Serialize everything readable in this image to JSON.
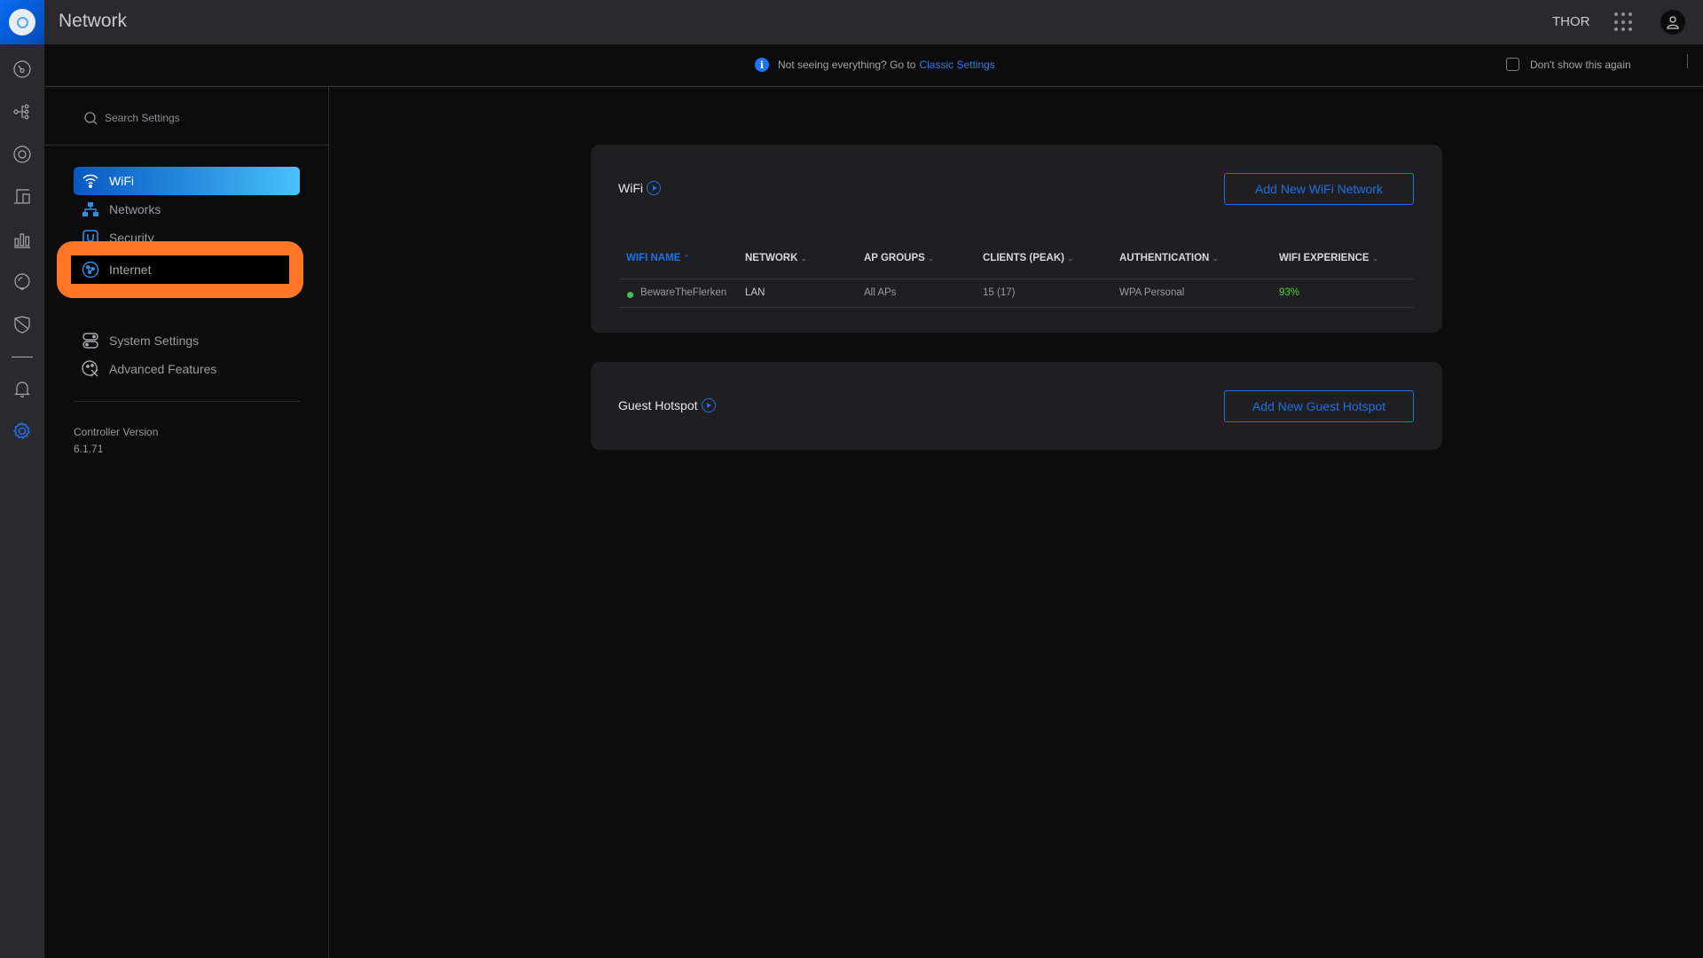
{
  "app": {
    "title": "Network",
    "user": "THOR"
  },
  "rail": {
    "items": [
      {
        "name": "dashboard",
        "icon": "gauge-icon"
      },
      {
        "name": "topology",
        "icon": "topology-icon"
      },
      {
        "name": "devices",
        "icon": "device-icon"
      },
      {
        "name": "clients",
        "icon": "clients-icon"
      },
      {
        "name": "statistics",
        "icon": "bar-chart-icon"
      },
      {
        "name": "insights",
        "icon": "bulb-icon"
      },
      {
        "name": "threat-management",
        "icon": "shield-icon"
      },
      {
        "name": "alerts",
        "icon": "bell-icon"
      },
      {
        "name": "settings",
        "icon": "gear-icon",
        "active": true
      }
    ]
  },
  "banner": {
    "message": "Not seeing everything? Go to",
    "link_label": "Classic Settings",
    "dont_show_label": "Don't show this again"
  },
  "settings_nav": {
    "search_placeholder": "Search Settings",
    "items": [
      {
        "label": "WiFi",
        "icon": "wifi-icon",
        "active": true
      },
      {
        "label": "Networks",
        "icon": "networks-icon"
      },
      {
        "label": "Security",
        "icon": "security-icon"
      },
      {
        "label": "Internet",
        "icon": "globe-icon",
        "highlighted": true
      },
      {
        "label": "System Settings",
        "icon": "toggles-icon"
      },
      {
        "label": "Advanced Features",
        "icon": "tools-icon"
      }
    ],
    "version_label": "Controller Version",
    "version_value": "6.1.71"
  },
  "wifi_card": {
    "title": "WiFi",
    "add_button": "Add New WiFi Network",
    "columns": [
      {
        "label": "WIFI NAME",
        "sorted": "asc"
      },
      {
        "label": "NETWORK"
      },
      {
        "label": "AP GROUPS"
      },
      {
        "label": "CLIENTS (PEAK)"
      },
      {
        "label": "AUTHENTICATION"
      },
      {
        "label": "WIFI EXPERIENCE"
      }
    ],
    "rows": [
      {
        "status": "online",
        "status_color": "#3ec35a",
        "name": "BewareTheFlerken",
        "network": "LAN",
        "ap_groups": "All APs",
        "clients": "15 (17)",
        "authentication": "WPA Personal",
        "experience": "93%",
        "experience_color": "#58d038"
      }
    ]
  },
  "guest_card": {
    "title": "Guest Hotspot",
    "add_button": "Add New Guest Hotspot"
  },
  "colors": {
    "accent": "#1f6fe6",
    "highlight_annotation": "#ff7627",
    "topbar": "#29292e",
    "card": "#1f1f21",
    "background": "#0c0c0d"
  }
}
